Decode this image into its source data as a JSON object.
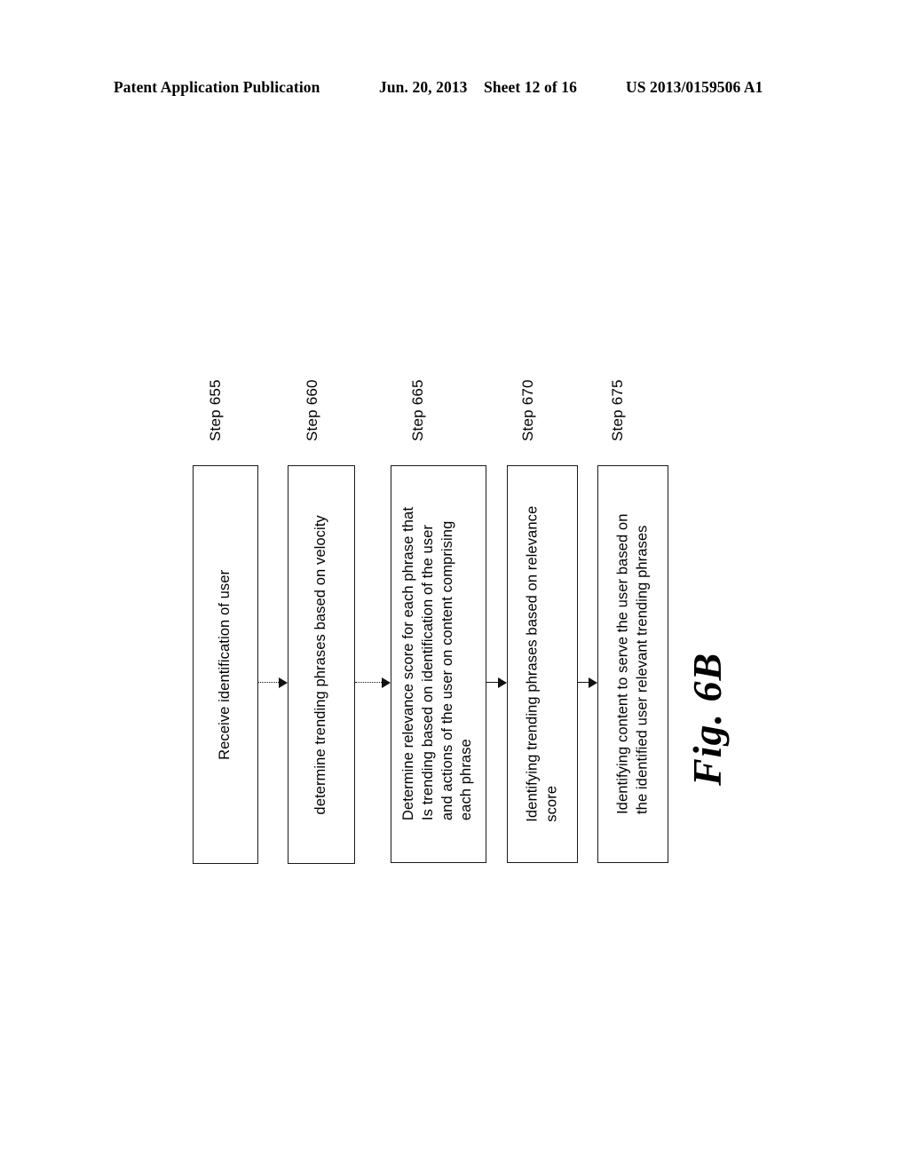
{
  "header": {
    "publication": "Patent Application Publication",
    "date": "Jun. 20, 2013",
    "sheet": "Sheet 12 of 16",
    "patent_number": "US 2013/0159506 A1"
  },
  "figure": {
    "caption": "Fig. 6B"
  },
  "flow": {
    "steps": [
      {
        "ref": "Step 655",
        "text": "Receive identification of user"
      },
      {
        "ref": "Step 660",
        "text": "determine trending phrases based on velocity"
      },
      {
        "ref": "Step 665",
        "text": "Determine relevance score for each phrase that\nIs trending based on identification of the user\nand actions of the user on content comprising\neach phrase"
      },
      {
        "ref": "Step 670",
        "text": "Identifying trending phrases based on relevance\nscore"
      },
      {
        "ref": "Step 675",
        "text": "Identifying content to serve the user based on\nthe identified user relevant trending phrases"
      }
    ],
    "connectors": [
      {
        "style": "dotted"
      },
      {
        "style": "dotted"
      },
      {
        "style": "solid"
      },
      {
        "style": "solid"
      }
    ]
  }
}
